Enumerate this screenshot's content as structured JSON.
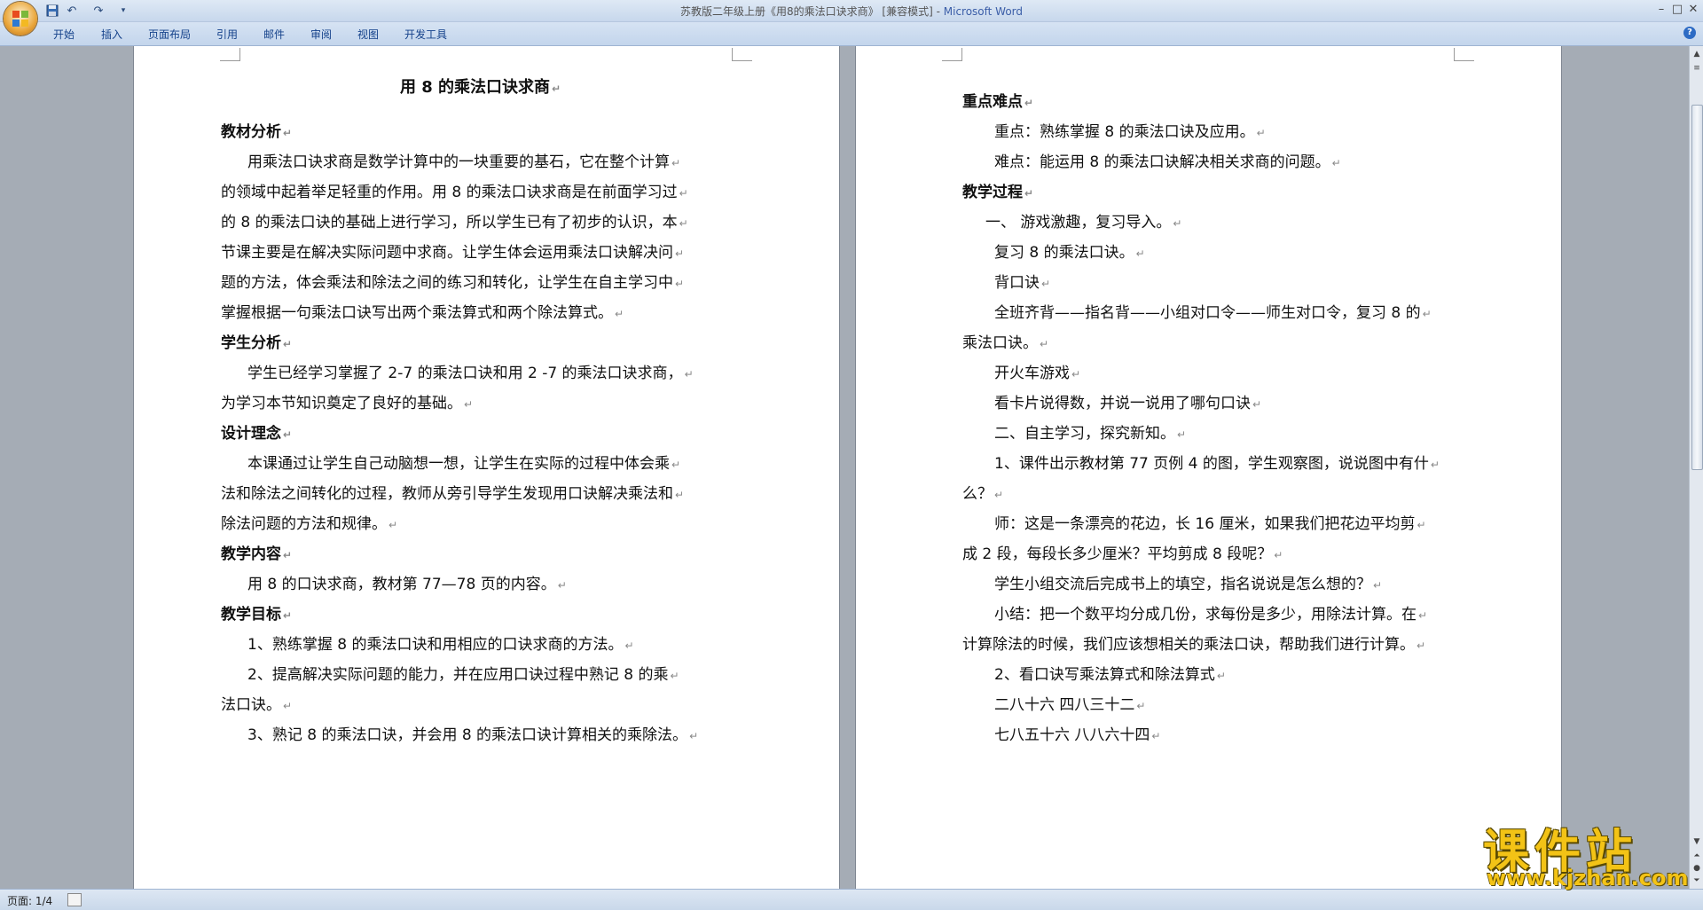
{
  "window": {
    "title": "苏教版二年级上册《用8的乘法口诀求商》 [兼容模式] - ",
    "app_name": "Microsoft Word",
    "undo_icon": "↶",
    "redo_icon": "↷",
    "customize_icon": "▾",
    "minimize": "–",
    "maximize": "□",
    "close": "✕"
  },
  "ribbon": {
    "tabs": [
      "开始",
      "插入",
      "页面布局",
      "引用",
      "邮件",
      "审阅",
      "视图",
      "开发工具"
    ],
    "help": "?"
  },
  "paragraph_mark": "↵",
  "left_page": {
    "title": "用 8 的乘法口诀求商",
    "lines": [
      "教材分析",
      "用乘法口诀求商是数学计算中的一块重要的基石，它在整个计算",
      "的领域中起着举足轻重的作用。用 8 的乘法口诀求商是在前面学习过",
      "的 8 的乘法口诀的基础上进行学习，所以学生已有了初步的认识，本",
      "节课主要是在解决实际问题中求商。让学生体会运用乘法口诀解决问",
      "题的方法，体会乘法和除法之间的练习和转化，让学生在自主学习中",
      "掌握根据一句乘法口诀写出两个乘法算式和两个除法算式。",
      "学生分析",
      "学生已经学习掌握了 2-7 的乘法口诀和用 2 -7 的乘法口诀求商，",
      "为学习本节知识奠定了良好的基础。",
      "设计理念",
      "本课通过让学生自己动脑想一想，让学生在实际的过程中体会乘",
      "法和除法之间转化的过程，教师从旁引导学生发现用口诀解决乘法和",
      "除法问题的方法和规律。",
      "教学内容",
      "用 8 的口诀求商，教材第 77—78 页的内容。",
      "教学目标",
      "1、熟练掌握 8 的乘法口诀和用相应的口诀求商的方法。",
      "2、提高解决实际问题的能力，并在应用口诀过程中熟记 8 的乘",
      "法口诀。",
      "3、熟记 8 的乘法口诀，并会用 8 的乘法口诀计算相关的乘除法。"
    ]
  },
  "right_page": {
    "lines": [
      "重点难点",
      "重点：熟练掌握 8 的乘法口诀及应用。",
      "难点：能运用 8 的乘法口诀解决相关求商的问题。",
      "教学过程",
      "一、   游戏激趣，复习导入。",
      "复习 8 的乘法口诀。",
      "背口诀",
      "全班齐背——指名背——小组对口令——师生对口令，复习 8 的",
      "乘法口诀。",
      "开火车游戏",
      "看卡片说得数，并说一说用了哪句口诀",
      "二、自主学习，探究新知。",
      "1、课件出示教材第 77 页例 4 的图，学生观察图，说说图中有什",
      "么？",
      "师：这是一条漂亮的花边，长 16 厘米，如果我们把花边平均剪",
      "成 2 段，每段长多少厘米？平均剪成 8 段呢？",
      "学生小组交流后完成书上的填空，指名说说是怎么想的？",
      "小结：把一个数平均分成几份，求每份是多少，用除法计算。在",
      "计算除法的时候，我们应该想相关的乘法口诀，帮助我们进行计算。",
      "2、看口诀写乘法算式和除法算式",
      "二八十六            四八三十二",
      "七八五十六         八八六十四"
    ]
  },
  "status": {
    "page": "页面: 1/4"
  },
  "watermark": {
    "text": "课件站",
    "url": "www.kjzhan.com"
  }
}
